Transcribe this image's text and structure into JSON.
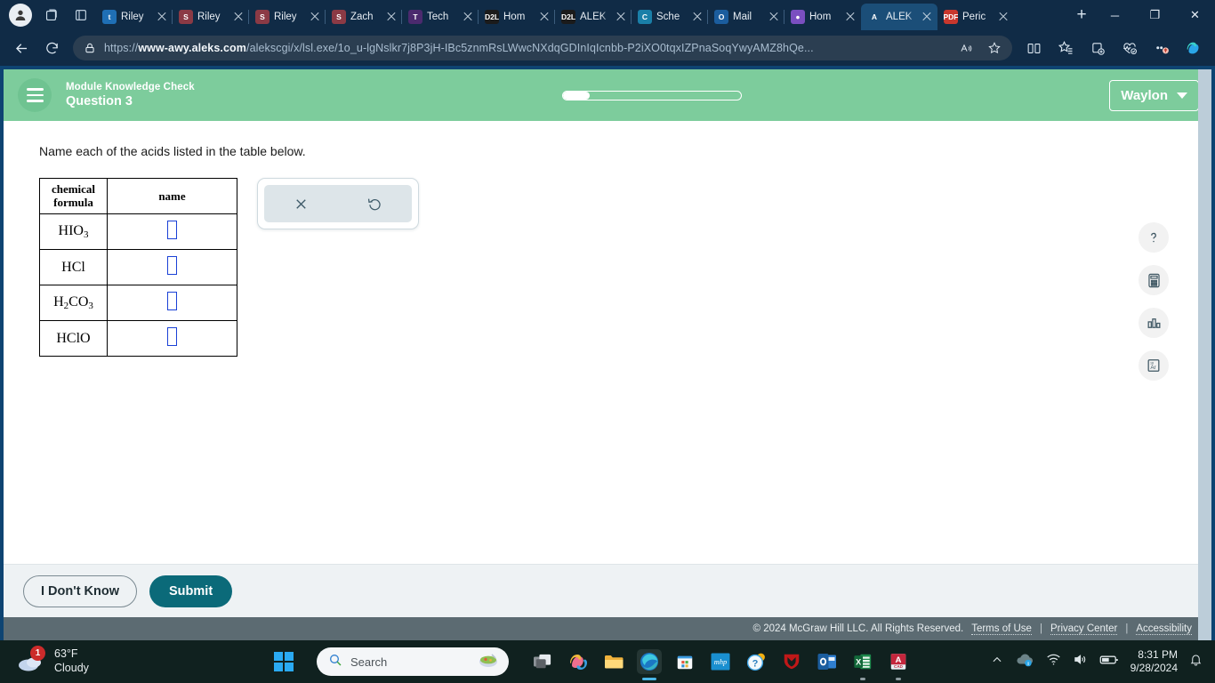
{
  "browser": {
    "profile_icon": "account-avatar-icon",
    "workspaces_icon": "workspaces-icon",
    "tabsearch_icon": "tab-actions-icon",
    "tabs": [
      {
        "title": "Riley",
        "fav": "t",
        "fav_bg": "#1f6fb5",
        "active": false
      },
      {
        "title": "Riley",
        "fav": "S",
        "fav_bg": "#8b3a45",
        "active": false
      },
      {
        "title": "Riley",
        "fav": "S",
        "fav_bg": "#8b3a45",
        "active": false
      },
      {
        "title": "Zach",
        "fav": "S",
        "fav_bg": "#8b3a45",
        "active": false
      },
      {
        "title": "Tech",
        "fav": "T",
        "fav_bg": "#4b2a6e",
        "active": false
      },
      {
        "title": "Hom",
        "fav": "D2L",
        "fav_bg": "#1b1b1b",
        "active": false
      },
      {
        "title": "ALEK",
        "fav": "D2L",
        "fav_bg": "#1b1b1b",
        "active": false
      },
      {
        "title": "Sche",
        "fav": "C",
        "fav_bg": "#1a7fa8",
        "active": false
      },
      {
        "title": "Mail",
        "fav": "O",
        "fav_bg": "#1b5d9e",
        "active": false
      },
      {
        "title": "Hom",
        "fav": "●",
        "fav_bg": "#7a4fc0",
        "active": false
      },
      {
        "title": "ALEK",
        "fav": "A",
        "fav_bg": "#1b4e78",
        "active": true
      },
      {
        "title": "Peric",
        "fav": "PDF",
        "fav_bg": "#c8372d",
        "active": false
      }
    ],
    "new_tab_label": "+",
    "window_controls": {
      "minimize": "─",
      "maximize": "❐",
      "close": "✕"
    },
    "back_icon": "back-arrow-icon",
    "reload_icon": "reload-icon",
    "url_prefix": "https://",
    "url_domain": "www-awy.aleks.com",
    "url_path": "/alekscgi/x/lsl.exe/1o_u-lgNslkr7j8P3jH-IBc5znmRsLWwcNXdqGDInIqIcnbb-P2iXO0tqxIZPnaSoqYwyAMZ8hQe...",
    "read_aloud_icon": "read-aloud-icon",
    "favorite_icon": "favorite-star-icon",
    "split_icon": "split-screen-icon",
    "favorites_icon": "favorites-hub-icon",
    "collections_icon": "collections-icon",
    "essentials_icon": "browser-essentials-icon",
    "settings_icon": "settings-more-icon",
    "copilot_icon": "copilot-icon"
  },
  "aleks": {
    "menu_icon": "hamburger-menu-icon",
    "assignment_title": "Module Knowledge Check",
    "question_label": "Question 3",
    "progress_percent": 15,
    "user_name": "Waylon",
    "question_text": "Name each of the acids listed in the table below.",
    "table": {
      "headers": [
        "chemical formula",
        "name"
      ],
      "header_formula_line1": "chemical",
      "header_formula_line2": "formula",
      "rows": [
        {
          "formula_html": "HIO<sub>3</sub>",
          "formula_text": "HIO3",
          "name_value": ""
        },
        {
          "formula_html": "HCl",
          "formula_text": "HCl",
          "name_value": ""
        },
        {
          "formula_html": "H<sub>2</sub>CO<sub>3</sub>",
          "formula_text": "H2CO3",
          "name_value": ""
        },
        {
          "formula_html": "HClO",
          "formula_text": "HClO",
          "name_value": ""
        }
      ]
    },
    "tool_panel": {
      "clear_icon": "clear-x-icon",
      "undo_icon": "undo-icon"
    },
    "rail": [
      {
        "name": "help-icon",
        "label": "?"
      },
      {
        "name": "calculator-icon",
        "label": ""
      },
      {
        "name": "bar-chart-icon",
        "label": ""
      },
      {
        "name": "periodic-table-icon",
        "label": "Ar",
        "number": "18"
      }
    ],
    "dont_know_label": "I Don't Know",
    "submit_label": "Submit",
    "footer": {
      "copyright": "© 2024 McGraw Hill LLC. All Rights Reserved.",
      "links": [
        "Terms of Use",
        "Privacy Center",
        "Accessibility"
      ],
      "separator": "|"
    }
  },
  "taskbar": {
    "weather_temp": "63°F",
    "weather_cond": "Cloudy",
    "weather_badge": "1",
    "start_icon": "windows-start-icon",
    "search_placeholder": "Search",
    "search_icon": "search-icon",
    "apps": [
      {
        "name": "task-view-icon"
      },
      {
        "name": "copilot-icon"
      },
      {
        "name": "file-explorer-icon"
      },
      {
        "name": "edge-browser-icon",
        "active": true
      },
      {
        "name": "microsoft-store-icon"
      },
      {
        "name": "mheducation-icon",
        "label": "mhp"
      },
      {
        "name": "get-help-icon"
      },
      {
        "name": "mcafee-icon"
      },
      {
        "name": "outlook-icon",
        "label": "O"
      },
      {
        "name": "excel-icon",
        "label": "X",
        "running": true
      },
      {
        "name": "autocad-icon",
        "label": "A",
        "sub": "CAD",
        "running": true
      }
    ],
    "tray": {
      "overflow_icon": "show-hidden-icons-icon",
      "onedrive_icon": "onedrive-icon",
      "wifi_icon": "wifi-icon",
      "volume_icon": "volume-icon",
      "battery_icon": "battery-icon",
      "time": "8:31 PM",
      "date": "9/28/2024",
      "notification_icon": "notifications-bell-icon"
    }
  }
}
